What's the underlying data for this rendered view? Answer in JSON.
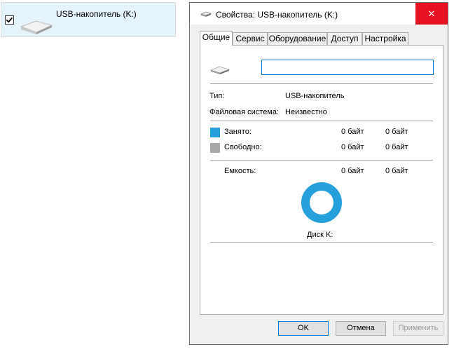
{
  "explorer": {
    "drive_label": "USB-накопитель (K:)",
    "checked": true
  },
  "dialog": {
    "title": "Свойства: USB-накопитель (K:)",
    "close_symbol": "✕",
    "tabs": [
      {
        "label": "Общие",
        "active": true
      },
      {
        "label": "Сервис",
        "active": false
      },
      {
        "label": "Оборудование",
        "active": false
      },
      {
        "label": "Доступ",
        "active": false
      },
      {
        "label": "Настройка",
        "active": false
      }
    ],
    "general": {
      "name_value": "",
      "type_label": "Тип:",
      "type_value": "USB-накопитель",
      "fs_label": "Файловая система:",
      "fs_value": "Неизвестно",
      "used": {
        "label": "Занято:",
        "bytes": "0 байт",
        "size": "0 байт",
        "color": "#26a0da"
      },
      "free": {
        "label": "Свободно:",
        "bytes": "0 байт",
        "size": "0 байт",
        "color": "#a8a8a8"
      },
      "capacity": {
        "label": "Емкость:",
        "bytes": "0 байт",
        "size": "0 байт"
      },
      "disk_label": "Диск K:",
      "ring_color": "#26a0da"
    },
    "buttons": {
      "ok": "OK",
      "cancel": "Отмена",
      "apply": "Применить"
    }
  }
}
